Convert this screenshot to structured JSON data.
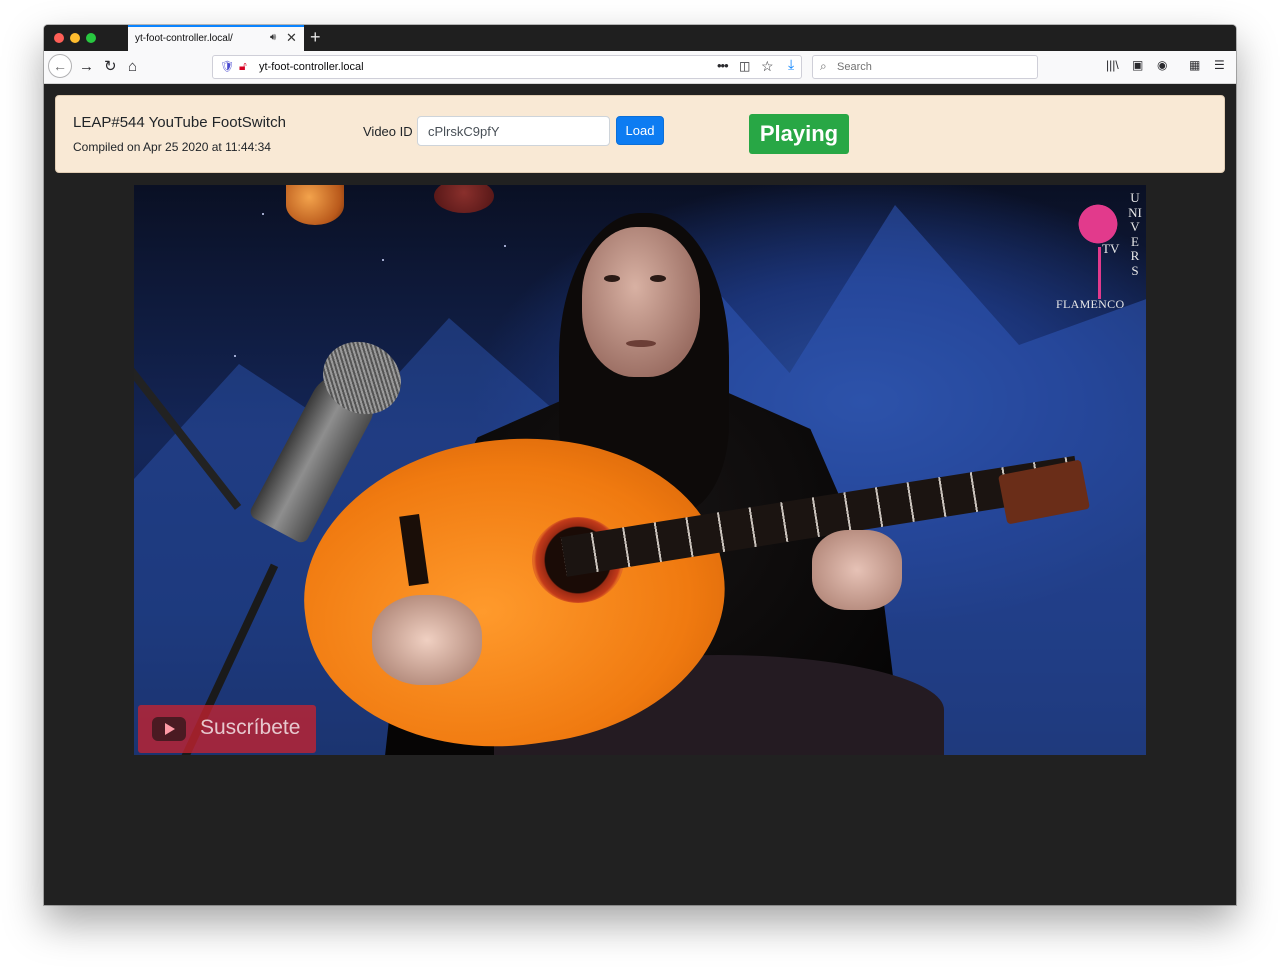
{
  "browser": {
    "tab_title": "yt-foot-controller.local/",
    "tab_audio_icon": "speaker-icon",
    "tab_close": "✕",
    "new_tab": "+",
    "url": "yt-foot-controller.local",
    "search_placeholder": "Search"
  },
  "header": {
    "title": "LEAP#544 YouTube FootSwitch",
    "compiled": "Compiled on Apr 25 2020 at 11:44:34",
    "video_id_label": "Video ID",
    "video_id_value": "cPlrskC9pfY",
    "load_label": "Load",
    "status": "Playing"
  },
  "video": {
    "watermark_letters": "UNIVERS",
    "watermark_tv": "TV",
    "watermark_brand": "FLAMENCO",
    "subscribe_label": "Suscríbete"
  },
  "colors": {
    "status_green": "#28a745",
    "load_blue": "#0d7cf2",
    "header_bg": "#f9e9d5",
    "page_bg": "#212121"
  }
}
